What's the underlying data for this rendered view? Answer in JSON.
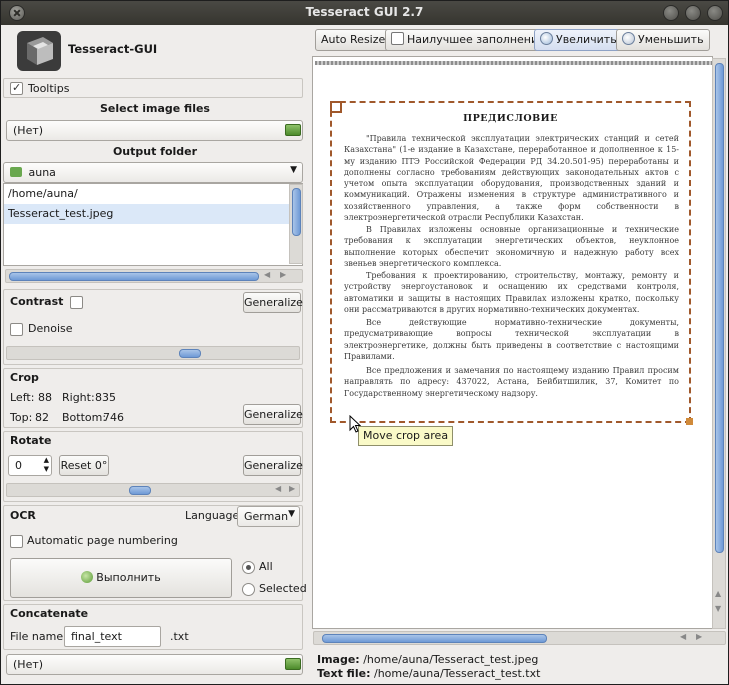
{
  "window": {
    "title": "Tesseract GUI 2.7"
  },
  "app": {
    "name": "Tesseract-GUI"
  },
  "tooltips": {
    "label": "Tooltips",
    "checked": true
  },
  "image_files": {
    "header": "Select image files",
    "value": "(Нет)"
  },
  "output": {
    "header": "Output folder",
    "folder": "auna",
    "files": [
      "/home/auna/",
      "Tesseract_test.jpeg"
    ]
  },
  "contrast": {
    "label": "Contrast",
    "checked": false,
    "button": "Generalize",
    "denoise_label": "Denoise",
    "denoise_checked": false
  },
  "crop": {
    "header": "Crop",
    "left_label": "Left:",
    "left": "88",
    "right_label": "Right:",
    "right": "835",
    "top_label": "Top:",
    "top": "82",
    "bottom_label": "Bottom:",
    "bottom": "746",
    "button": "Generalize"
  },
  "rotate": {
    "header": "Rotate",
    "value": "0",
    "reset_button": "Reset 0°",
    "button": "Generalize"
  },
  "ocr": {
    "header": "OCR",
    "language_label": "Language",
    "language": "German",
    "auto_numbering": "Automatic page numbering",
    "run_button": "Выполнить",
    "all_label": "All",
    "selected_label": "Selected"
  },
  "concatenate": {
    "header": "Concatenate",
    "file_label": "File name",
    "file_value": "final_text",
    "ext": ".txt",
    "combo": "(Нет)"
  },
  "toolbar": {
    "auto_resize": "Auto Resize",
    "best_fit": "Наилучшее заполнение",
    "zoom_in": "Увеличить",
    "zoom_out": "Уменьшить"
  },
  "document": {
    "title": "ПРЕДИСЛОВИЕ",
    "paragraphs": [
      "\"Правила технической эксплуатации электрических станций и сетей Казахстана\" (1-е издание в Казахстане, переработанное и дополненное к 15-му изданию ПТЭ Российской Федерации РД 34.20.501-95) переработаны и дополнены согласно требованиям действующих законодательных актов с учетом опыта эксплуатации оборудования, производственных зданий и коммуникаций. Отражены изменения в структуре административного и хозяйственного управления, а также форм собственности в электроэнергетической отрасли Республики Казахстан.",
      "В Правилах изложены основные организационные и технические требования к эксплуатации энергетических объектов, неуклонное выполнение которых обеспечит экономичную и надежную работу всех звеньев энергетического комплекса.",
      "Требования к проектированию, строительству, монтажу, ремонту и устройству энергоустановок и оснащению их средствами контроля, автоматики и защиты в настоящих Правилах изложены кратко, поскольку они рассматриваются в других нормативно-технических документах.",
      "Все действующие нормативно-технические документы, предусматривающие вопросы технической эксплуатации в электроэнергетике, должны быть приведены в соответствие с настоящими Правилами.",
      "Все предложения и замечания по настоящему изданию Правил просим направлять по адресу: 437022, Астана, Бейбитшилик, 37, Комитет по Государственному энергетическому надзору."
    ]
  },
  "tooltip": "Move crop area",
  "status": {
    "image_label": "Image:",
    "image_path": "/home/auna/Tesseract_test.jpeg",
    "text_label": "Text file:",
    "text_path": "/home/auna/Tesseract_test.txt"
  }
}
